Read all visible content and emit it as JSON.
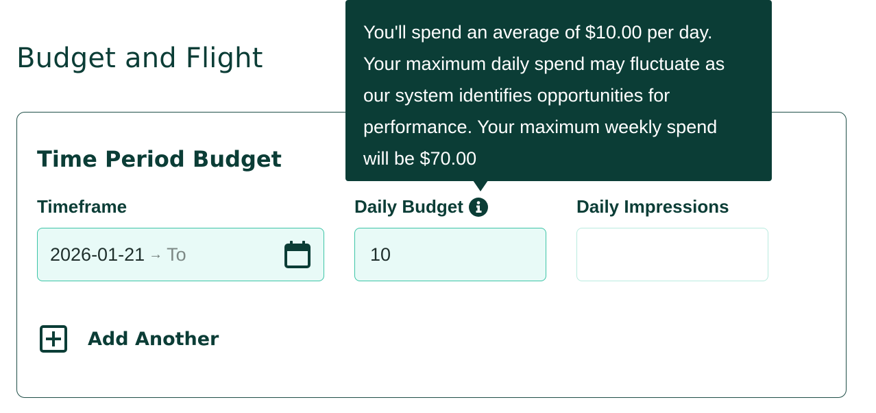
{
  "section": {
    "title": "Budget and Flight"
  },
  "card": {
    "title": "Time Period Budget",
    "add_another_label": "Add Another"
  },
  "fields": {
    "timeframe": {
      "label": "Timeframe",
      "start_value": "2026-01-21",
      "arrow": "→",
      "end_placeholder": "To",
      "icon": "calendar-icon"
    },
    "daily_budget": {
      "label": "Daily Budget",
      "value": "10",
      "icon": "info-icon"
    },
    "daily_impressions": {
      "label": "Daily Impressions",
      "value": ""
    }
  },
  "tooltip": {
    "lines": [
      "You'll spend an average of $10.00 per day.",
      "Your maximum daily spend may fluctuate as",
      "our system identifies opportunities for",
      "performance. Your maximum weekly spend",
      "will be $70.00"
    ]
  },
  "colors": {
    "primary": "#0b3d36",
    "input_fill": "#e8faf7",
    "input_border": "#3cc4a6",
    "input_border_empty": "#b9ebdf",
    "tooltip_bg": "#0b3d36"
  }
}
